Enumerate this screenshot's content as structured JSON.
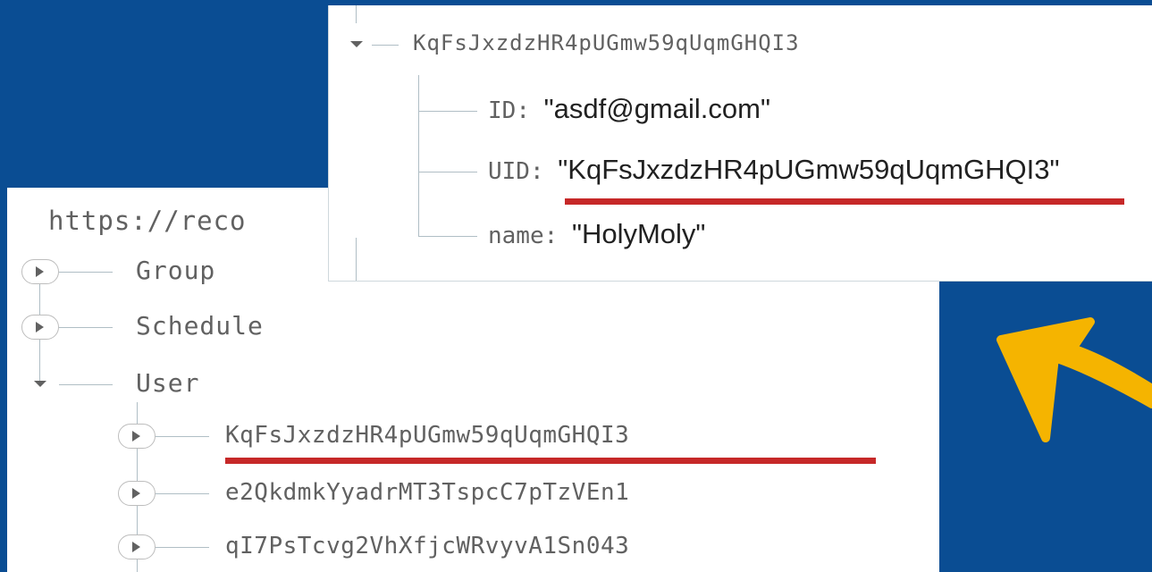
{
  "database": {
    "url_text": "https://reco",
    "nodes": [
      {
        "label": "Group"
      },
      {
        "label": "Schedule"
      },
      {
        "label": "User"
      }
    ],
    "user_children": [
      {
        "label": "KqFsJxzdzHR4pUGmw59qUqmGHQI3"
      },
      {
        "label": "e2QkdmkYyadrMT3TspcC7pTzVEn1"
      },
      {
        "label": "qI7PsTcvg2VhXfjcWRvyvA1Sn043"
      }
    ]
  },
  "detail": {
    "key": "KqFsJxzdzHR4pUGmw59qUqmGHQI3",
    "fields": [
      {
        "name": "ID",
        "value": "\"asdf@gmail.com\""
      },
      {
        "name": "UID",
        "value": "\"KqFsJxzdzHR4pUGmw59qUqmGHQI3\""
      },
      {
        "name": "name",
        "value": "\"HolyMoly\""
      }
    ]
  },
  "colors": {
    "background": "#0a4d93",
    "highlight": "#c62828",
    "arrow": "#f5b400"
  },
  "icons": [
    "expand-arrow-icon",
    "collapse-arrow-icon",
    "pointer-arrow"
  ]
}
